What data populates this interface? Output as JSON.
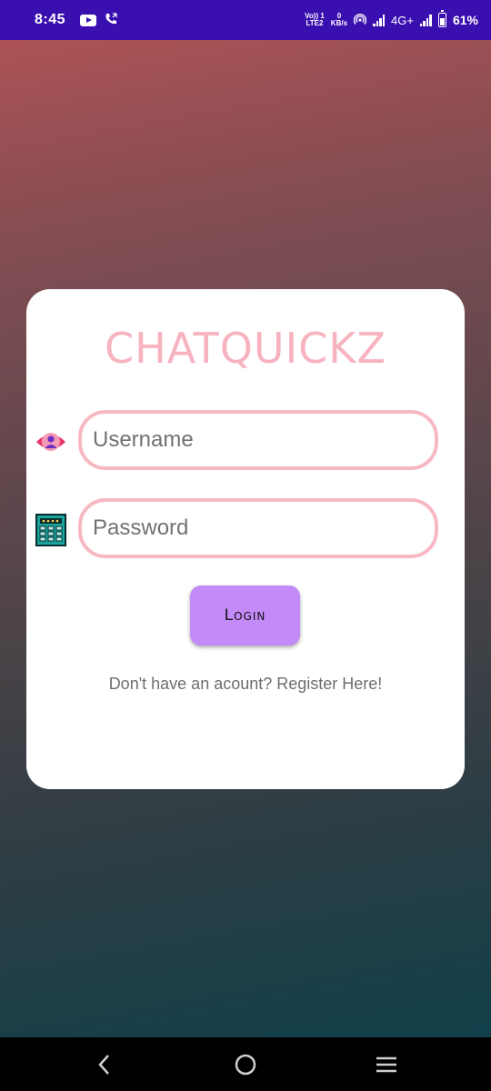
{
  "status_bar": {
    "time": "8:45",
    "volte_top": "Vo)) 1",
    "volte_bottom": "LTE2",
    "speed_top": "0",
    "speed_bottom": "KB/s",
    "network": "4G+",
    "battery": "61%",
    "icons": [
      "youtube-icon",
      "call-icon",
      "hotspot-icon",
      "signal-icon",
      "battery-icon"
    ]
  },
  "login": {
    "app_title": "CHATQUICKZ",
    "username_placeholder": "Username",
    "password_placeholder": "Password",
    "login_label": "Login",
    "register_text": "Don't have an acount? Register Here!",
    "icons": [
      "user-icon",
      "keypad-icon"
    ]
  },
  "colors": {
    "title": "#f7b3bf",
    "field_border": "#f7b8c4",
    "button": "#c38af8",
    "status_bar": "#3a0fb0"
  },
  "nav_bar": {
    "icons": [
      "back-icon",
      "home-icon",
      "recents-icon"
    ]
  }
}
